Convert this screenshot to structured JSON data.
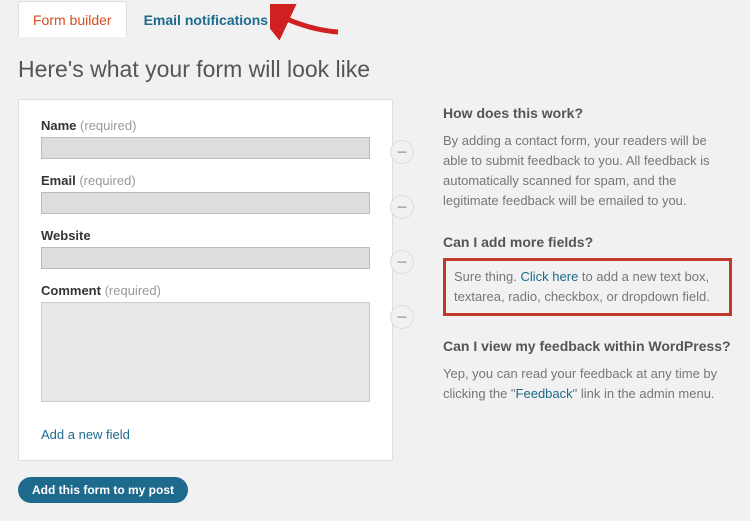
{
  "tabs": {
    "active": "Form builder",
    "inactive": "Email notifications"
  },
  "page_title": "Here's what your form will look like",
  "fields": [
    {
      "label": "Name",
      "required": "(required)",
      "type": "text"
    },
    {
      "label": "Email",
      "required": "(required)",
      "type": "text"
    },
    {
      "label": "Website",
      "required": "",
      "type": "text"
    },
    {
      "label": "Comment",
      "required": "(required)",
      "type": "textarea"
    }
  ],
  "add_field_link": "Add a new field",
  "sidebar": {
    "s1": {
      "heading": "How does this work?",
      "text": "By adding a contact form, your readers will be able to submit feedback to you. All feedback is automatically scanned for spam, and the legitimate feedback will be emailed to you."
    },
    "s2": {
      "heading": "Can I add more fields?",
      "pre": "Sure thing. ",
      "link": "Click here",
      "post": " to add a new text box, textarea, radio, checkbox, or dropdown field."
    },
    "s3": {
      "heading": "Can I view my feedback within WordPress?",
      "pre": "Yep, you can read your feedback at any time by clicking the \"",
      "link": "Feedback",
      "post": "\" link in the admin menu."
    }
  },
  "submit_label": "Add this form to my post",
  "minus_glyph": "−"
}
